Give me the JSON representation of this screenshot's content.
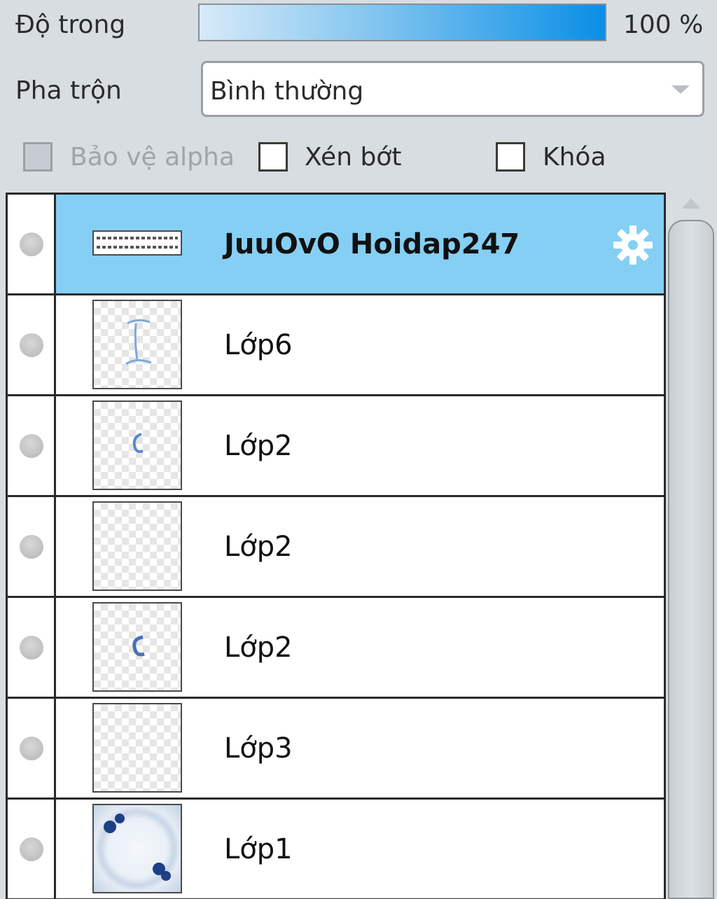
{
  "opacity": {
    "label": "Độ trong",
    "value_text": "100 %",
    "fraction": 1.0
  },
  "blend": {
    "label": "Pha trộn",
    "selected": "Bình thường"
  },
  "options": {
    "protect_alpha": {
      "label": "Bảo vệ alpha",
      "checked": false,
      "enabled": false
    },
    "clip": {
      "label": "Xén bớt",
      "checked": false,
      "enabled": true
    },
    "lock": {
      "label": "Khóa",
      "checked": false,
      "enabled": true
    }
  },
  "layers": [
    {
      "name": "JuuOvO Hoidap247",
      "selected": true,
      "kind": "text"
    },
    {
      "name": "Lớp6",
      "selected": false,
      "kind": "raster"
    },
    {
      "name": "Lớp2",
      "selected": false,
      "kind": "raster"
    },
    {
      "name": "Lớp2",
      "selected": false,
      "kind": "raster"
    },
    {
      "name": "Lớp2",
      "selected": false,
      "kind": "raster"
    },
    {
      "name": "Lớp3",
      "selected": false,
      "kind": "raster"
    },
    {
      "name": "Lớp1",
      "selected": false,
      "kind": "frame"
    }
  ],
  "colors": {
    "selection": "#85cff5",
    "slider_end": "#0a8fe6",
    "frame_flower": "#1d3f86"
  },
  "icons": {
    "layer_settings": "gear-icon",
    "visibility": "visibility-dot-icon",
    "dropdown": "chevron-down-icon"
  }
}
